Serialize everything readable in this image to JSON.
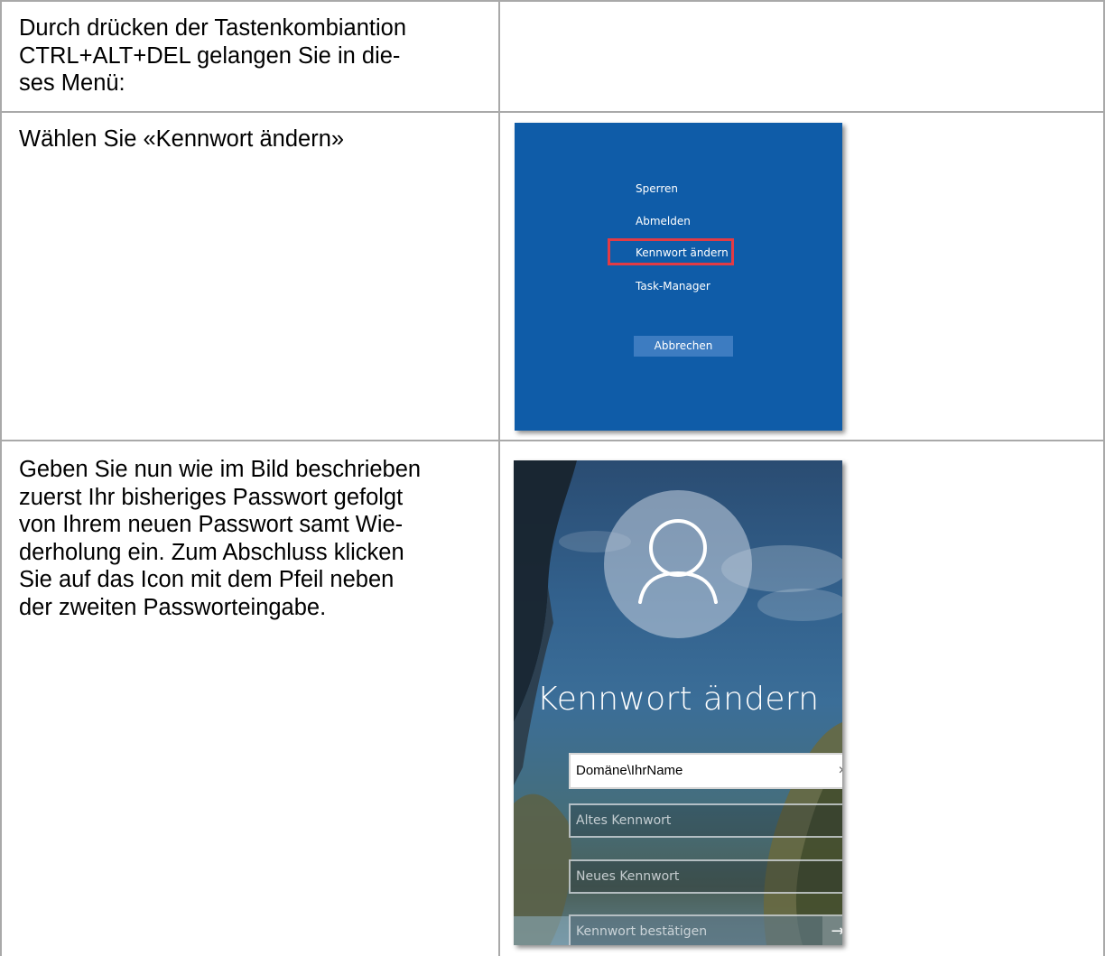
{
  "rows": [
    {
      "instruction_lines": [
        "Durch drücken der Tastenkombiantion",
        "CTRL+ALT+DEL gelangen Sie in die-",
        "ses Menü:"
      ]
    },
    {
      "instruction_lines": [
        "Wählen Sie «Kennwort ändern»"
      ],
      "screenshot": {
        "menu_items": [
          "Sperren",
          "Abmelden",
          "Kennwort ändern",
          "Task-Manager"
        ],
        "highlighted_item": "Kennwort ändern",
        "cancel_button": "Abbrechen",
        "background_color": "#0f5ca8",
        "highlight_color": "#e23b45"
      }
    },
    {
      "instruction_lines": [
        "Geben Sie nun wie im Bild beschrieben",
        "zuerst Ihr bisheriges Passwort gefolgt",
        "von Ihrem neuen Passwort samt Wie-",
        "derholung ein. Zum Abschluss klicken",
        "Sie auf das Icon mit dem Pfeil neben",
        "der zweiten Passworteingabe."
      ],
      "screenshot": {
        "avatar_icon": "user-avatar-icon",
        "title": "Kennwort ändern",
        "username_value": "Domäne\\IhrName",
        "clear_icon": "×",
        "old_password_placeholder": "Altes Kennwort",
        "new_password_placeholder": "Neues Kennwort",
        "confirm_password_placeholder": "Kennwort bestätigen",
        "submit_icon": "→"
      }
    }
  ]
}
